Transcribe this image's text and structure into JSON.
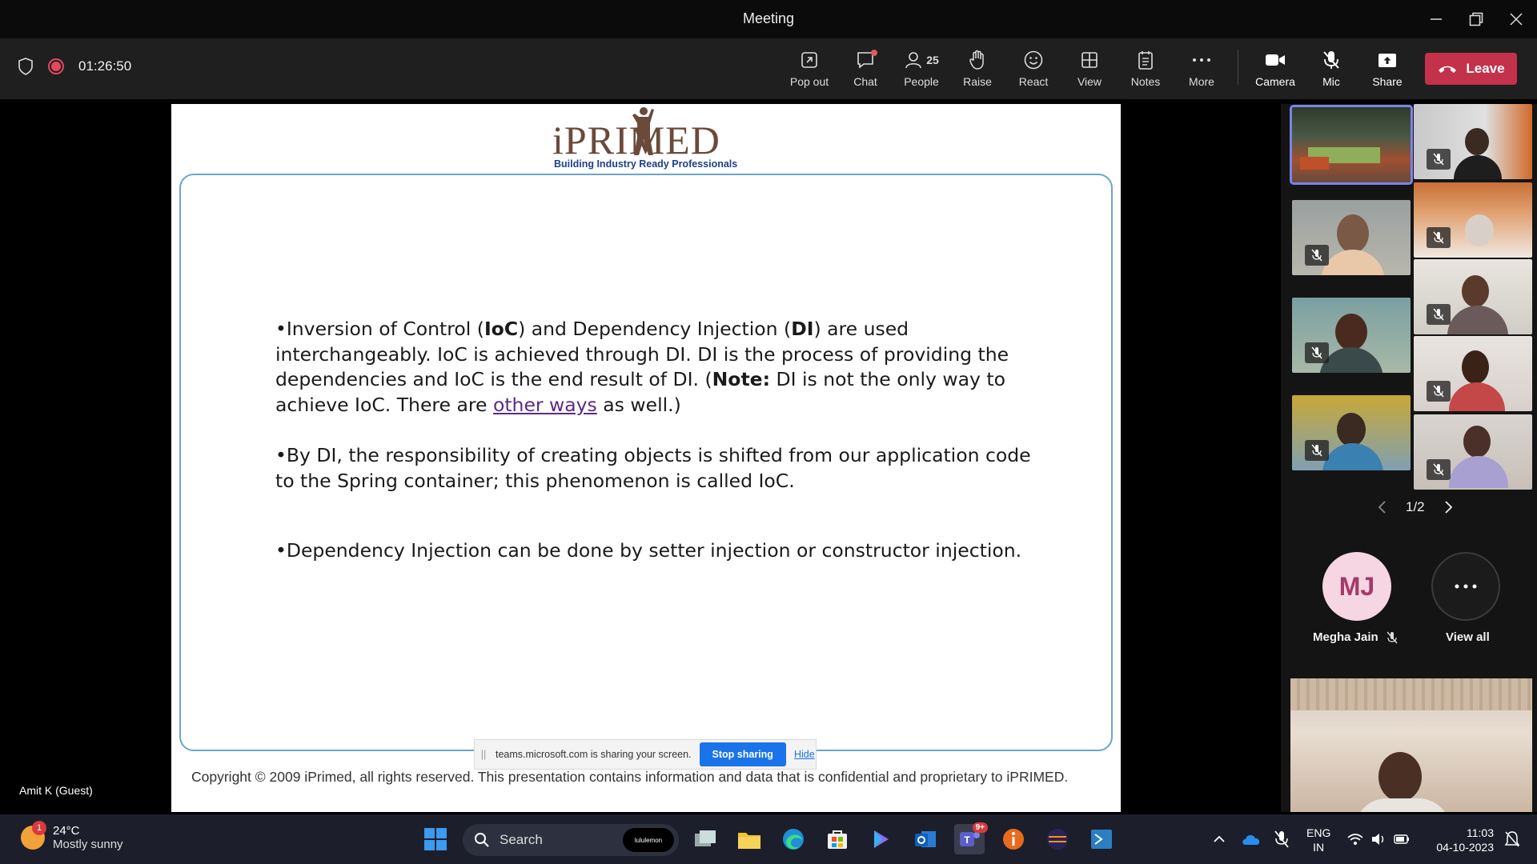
{
  "window": {
    "title": "Meeting"
  },
  "toolbar": {
    "timer": "01:26:50",
    "buttons": {
      "popout": "Pop out",
      "chat": "Chat",
      "people": "People",
      "people_count": "25",
      "raise": "Raise",
      "react": "React",
      "view": "View",
      "notes": "Notes",
      "more": "More",
      "camera": "Camera",
      "mic": "Mic",
      "share": "Share",
      "leave": "Leave"
    }
  },
  "slide": {
    "logo_brand": "iPRIMED",
    "logo_tagline": "Building Industry Ready Professionals",
    "para1_a": "•Inversion of Control (",
    "para1_b": "IoC",
    "para1_c": ") and Dependency Injection (",
    "para1_d": "DI",
    "para1_e": ") are used interchangeably. IoC is achieved through DI. DI is the process of providing the dependencies and IoC is the end result of DI. (",
    "para1_f": "Note:",
    "para1_g": " DI is not the only way to achieve IoC. There are ",
    "para1_link": "other ways",
    "para1_h": " as well.)",
    "para2": "•By DI, the responsibility of creating objects is shifted from our application code to the Spring container; this phenomenon is called IoC.",
    "para3": "•Dependency Injection can be done by setter injection or constructor injection.",
    "copyright": "Copyright © 2009 iPrimed, all rights reserved. This presentation contains information  and data  that is confidential and proprietary to iPRIMED."
  },
  "share_banner": {
    "text": "teams.microsoft.com is sharing your screen.",
    "stop": "Stop sharing",
    "hide": "Hide"
  },
  "presenter_name": "Amit K (Guest)",
  "gallery": {
    "pager": "1/2",
    "featured_initials": "MJ",
    "featured_name": "Megha Jain",
    "view_all": "View all"
  },
  "taskbar": {
    "weather_temp": "24°C",
    "weather_desc": "Mostly sunny",
    "weather_badge": "1",
    "search_label": "Search",
    "search_pill": "lululemon",
    "teams_badge": "9+",
    "lang1": "ENG",
    "lang2": "IN",
    "time": "11:03",
    "date": "04-10-2023"
  },
  "colors": {
    "leave": "#c4314b",
    "accent": "#7b83eb",
    "link": "#5c2a86"
  }
}
